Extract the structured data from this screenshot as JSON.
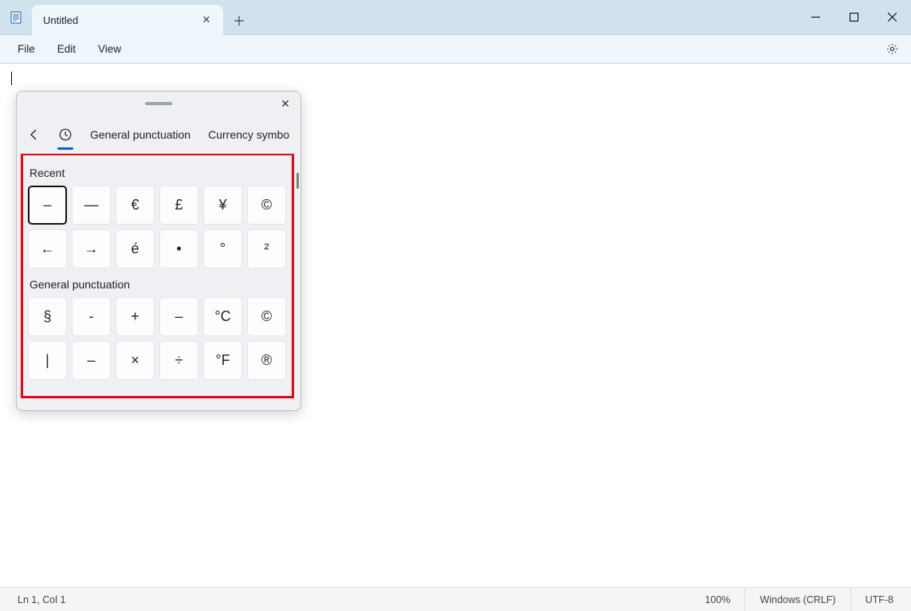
{
  "titlebar": {
    "tab_title": "Untitled"
  },
  "menubar": {
    "items": [
      "File",
      "Edit",
      "View"
    ]
  },
  "panel": {
    "tabs": {
      "recent_label": "",
      "general": "General punctuation",
      "currency": "Currency symbo"
    },
    "sections": {
      "recent": {
        "label": "Recent",
        "symbols": [
          "–",
          "—",
          "€",
          "£",
          "¥",
          "©",
          "←",
          "→",
          "é",
          "•",
          "°",
          "²"
        ]
      },
      "general": {
        "label": "General punctuation",
        "symbols": [
          "§",
          "-",
          "+",
          "–",
          "°C",
          "©",
          "|",
          "–",
          "×",
          "÷",
          "°F",
          "®"
        ]
      }
    }
  },
  "statusbar": {
    "position": "Ln 1, Col 1",
    "zoom": "100%",
    "line_ending": "Windows (CRLF)",
    "encoding": "UTF-8"
  }
}
